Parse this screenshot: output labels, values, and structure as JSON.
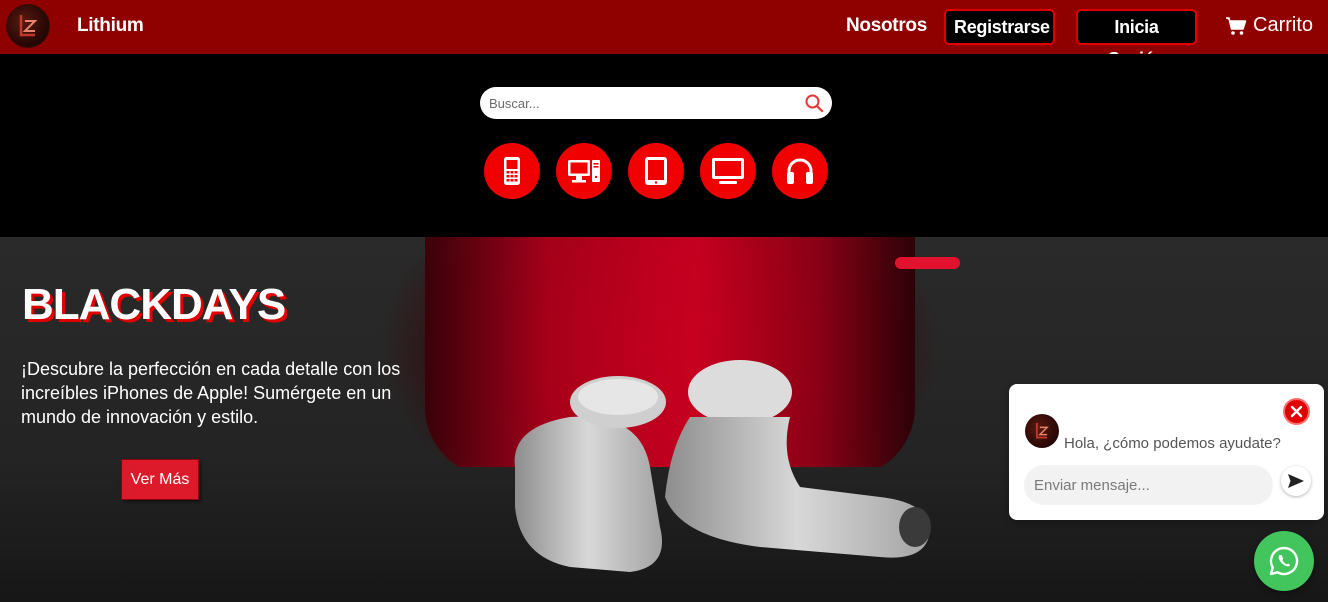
{
  "nav": {
    "brand": "Lithium",
    "links": {
      "about": "Nosotros",
      "register": "Registrarse",
      "login": "Inicia Sesión",
      "cart": "Carrito"
    }
  },
  "search": {
    "placeholder": "Buscar..."
  },
  "categories": [
    {
      "icon": "mobile-phone-icon"
    },
    {
      "icon": "desktop-computer-icon"
    },
    {
      "icon": "tablet-icon"
    },
    {
      "icon": "tv-monitor-icon"
    },
    {
      "icon": "headphones-icon"
    }
  ],
  "hero": {
    "title": "BLACKDAYS",
    "text": "¡Descubre la perfección en cada detalle con los increíbles iPhones de Apple! Sumérgete en un mundo de innovación y estilo.",
    "button": "Ver Más"
  },
  "chat": {
    "greeting": "Hola, ¿cómo podemos ayudate?",
    "input_placeholder": "Enviar mensaje..."
  },
  "colors": {
    "nav_bg": "#8f0000",
    "accent": "#f00000",
    "whatsapp": "#41c55c"
  }
}
